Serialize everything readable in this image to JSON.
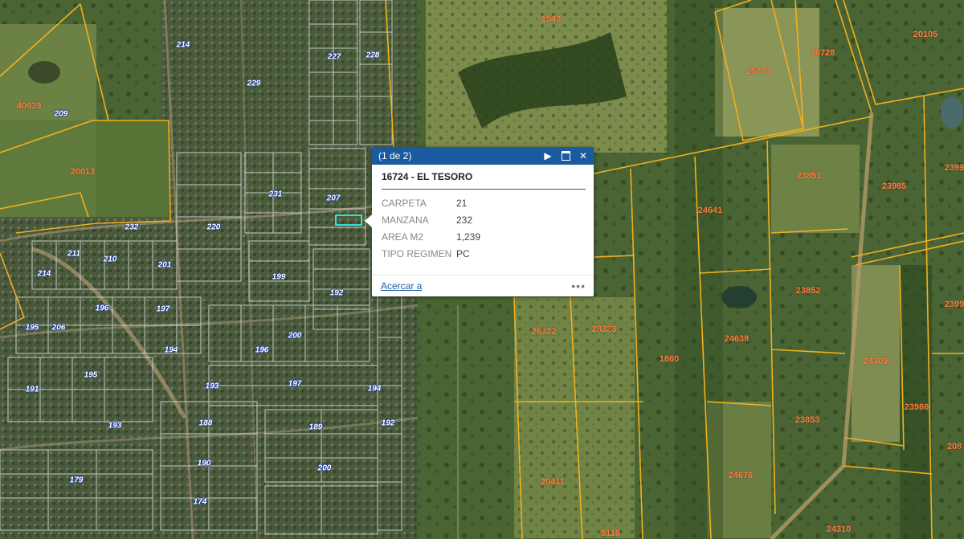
{
  "popup": {
    "counter": "(1 de 2)",
    "title": "16724 - EL TESORO",
    "attributes": [
      {
        "key": "CARPETA",
        "value": "21"
      },
      {
        "key": "MANZANA",
        "value": "232"
      },
      {
        "key": "AREA M2",
        "value": "1,239"
      },
      {
        "key": "TIPO REGIMEN",
        "value": "PC"
      }
    ],
    "zoom_label": "Acercar a",
    "more_label": "•••",
    "next_icon": "▶",
    "close_icon": "✕"
  },
  "map": {
    "rural_parcels": [
      "1543",
      "20728",
      "20105",
      "20774",
      "23851",
      "23985",
      "2399",
      "24641",
      "23852",
      "2399",
      "28322",
      "28323",
      "1860",
      "24638",
      "24309",
      "23853",
      "23986",
      "208",
      "20411",
      "24676",
      "24310",
      "5116",
      "40639",
      "20013"
    ],
    "urban_blocks": [
      "214",
      "227",
      "228",
      "229",
      "209",
      "231",
      "207",
      "220",
      "232",
      "211",
      "201",
      "210",
      "214",
      "199",
      "192",
      "196",
      "197",
      "195",
      "206",
      "200",
      "196",
      "194",
      "195",
      "193",
      "197",
      "194",
      "191",
      "193",
      "188",
      "189",
      "192",
      "190",
      "200",
      "179",
      "174"
    ],
    "colors": {
      "parcel_line": "#f2b01e",
      "rural_label": "#ff7a3c",
      "urban_label_outline": "#1f3f8f",
      "popup_header": "#1a5b9f",
      "selection": "#34e0d7"
    }
  }
}
